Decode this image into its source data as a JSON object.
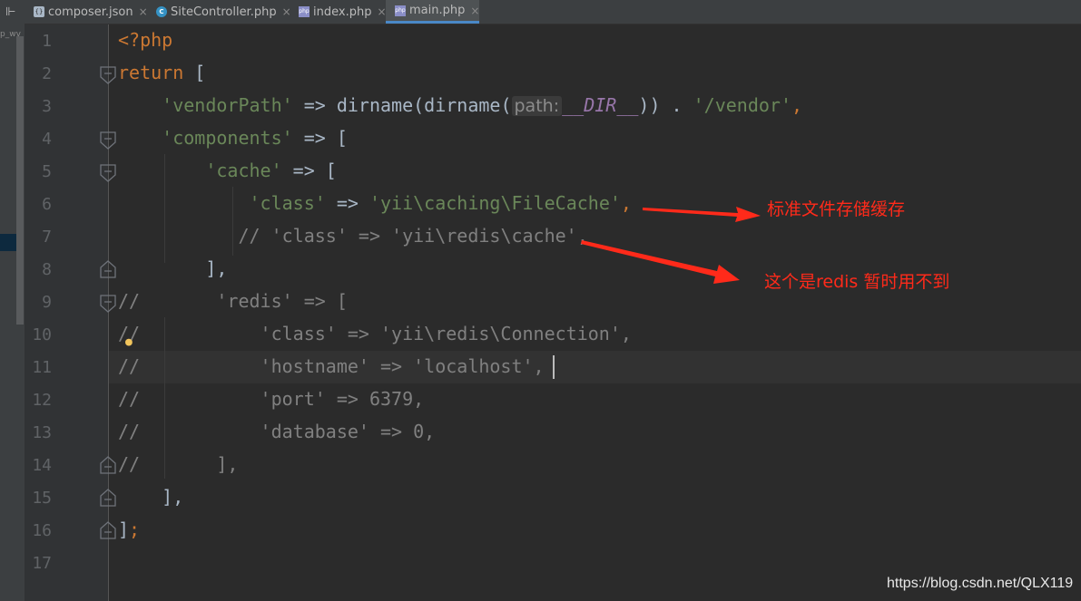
{
  "sidebar": {
    "marker": "⊩",
    "project_label": "p_wv"
  },
  "tabs": [
    {
      "label": "composer.json",
      "icon": "json-file-icon",
      "close": "×"
    },
    {
      "label": "SiteController.php",
      "icon": "php-class-icon",
      "close": "×"
    },
    {
      "label": "index.php",
      "icon": "php-file-icon",
      "close": "×"
    },
    {
      "label": "main.php",
      "icon": "php-file-icon",
      "close": "×",
      "active": true
    }
  ],
  "line_numbers": [
    "1",
    "2",
    "3",
    "4",
    "5",
    "6",
    "7",
    "8",
    "9",
    "10",
    "11",
    "12",
    "13",
    "14",
    "15",
    "16",
    "17"
  ],
  "code": {
    "l1": {
      "open": "<?php"
    },
    "l2": {
      "kw": "return",
      "rest": " ["
    },
    "l3": {
      "key": "'vendorPath'",
      "arrow": " => dirname(dirname(",
      "hint": "path:",
      "const": "__DIR__",
      "close": ")) . ",
      "val": "'/vendor'",
      "end": ","
    },
    "l4": {
      "key": "'components'",
      "rest": " => ["
    },
    "l5": {
      "key": "'cache'",
      "rest": " => ["
    },
    "l6": {
      "key": "'class'",
      "arrow": " => ",
      "val": "'yii\\caching\\FileCache'",
      "end": ","
    },
    "l7": {
      "text": "// 'class' => 'yii\\redis\\cache',"
    },
    "l8": {
      "text": "],"
    },
    "l9": {
      "text": "//       'redis' => ["
    },
    "l10": {
      "text": "//           'class' => 'yii\\redis\\Connection',"
    },
    "l11": {
      "text": "//           'hostname' => 'localhost',"
    },
    "l12": {
      "text": "//           'port' => 6379,"
    },
    "l13": {
      "text": "//           'database' => 0,"
    },
    "l14": {
      "text": "//       ],"
    },
    "l15": {
      "text": "],"
    },
    "l16": {
      "text": "]",
      "end": ";"
    }
  },
  "annotations": {
    "file_cache": "标准文件存储缓存",
    "redis_unused": "这个是redis 暂时用不到"
  },
  "watermark": "https://blog.csdn.net/QLX119",
  "colors": {
    "keyword": "#cc7832",
    "string": "#6a8759",
    "comment": "#808080",
    "annotation": "#ff2a1a",
    "background": "#2b2b2b"
  }
}
